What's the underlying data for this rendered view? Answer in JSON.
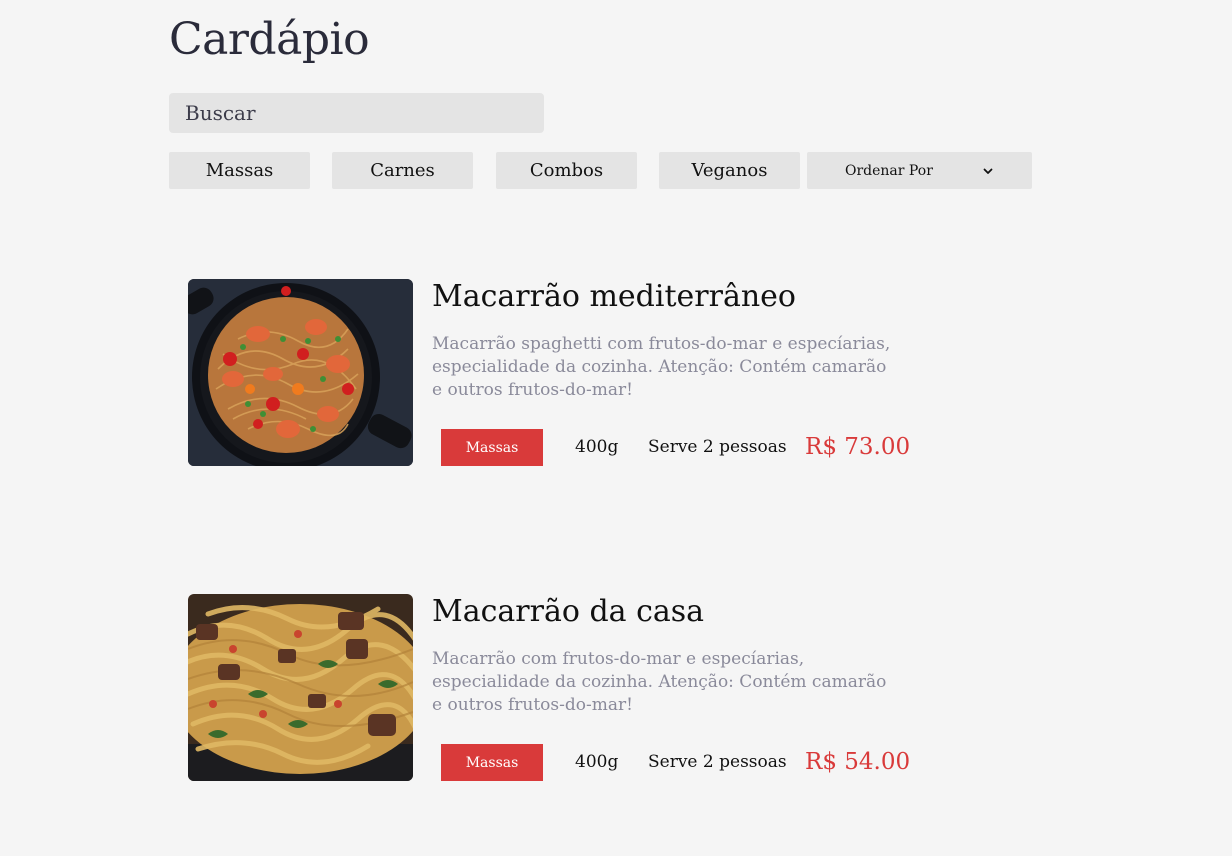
{
  "header": {
    "title": "Cardápio"
  },
  "search": {
    "placeholder": "Buscar"
  },
  "filters": {
    "categories": [
      "Massas",
      "Carnes",
      "Combos",
      "Veganos"
    ],
    "sort_label": "Ordenar Por"
  },
  "colors": {
    "accent": "#d93a3a",
    "background": "#f5f5f5",
    "control": "#e4e4e4",
    "muted_text": "#8a8a9a"
  },
  "menu_items": [
    {
      "title": "Macarrão mediterrâneo",
      "description": "Macarrão spaghetti com frutos-do-mar e especíarias, especialidade da cozinha. Atenção: Contém camarão e outros frutos-do-mar!",
      "category": "Massas",
      "weight": "400g",
      "serves": "Serve 2 pessoas",
      "price": "R$ 73.00"
    },
    {
      "title": "Macarrão da casa",
      "description": "Macarrão com frutos-do-mar e especíarias, especialidade da cozinha. Atenção: Contém camarão e outros frutos-do-mar!",
      "category": "Massas",
      "weight": "400g",
      "serves": "Serve 2 pessoas",
      "price": "R$ 54.00"
    }
  ]
}
